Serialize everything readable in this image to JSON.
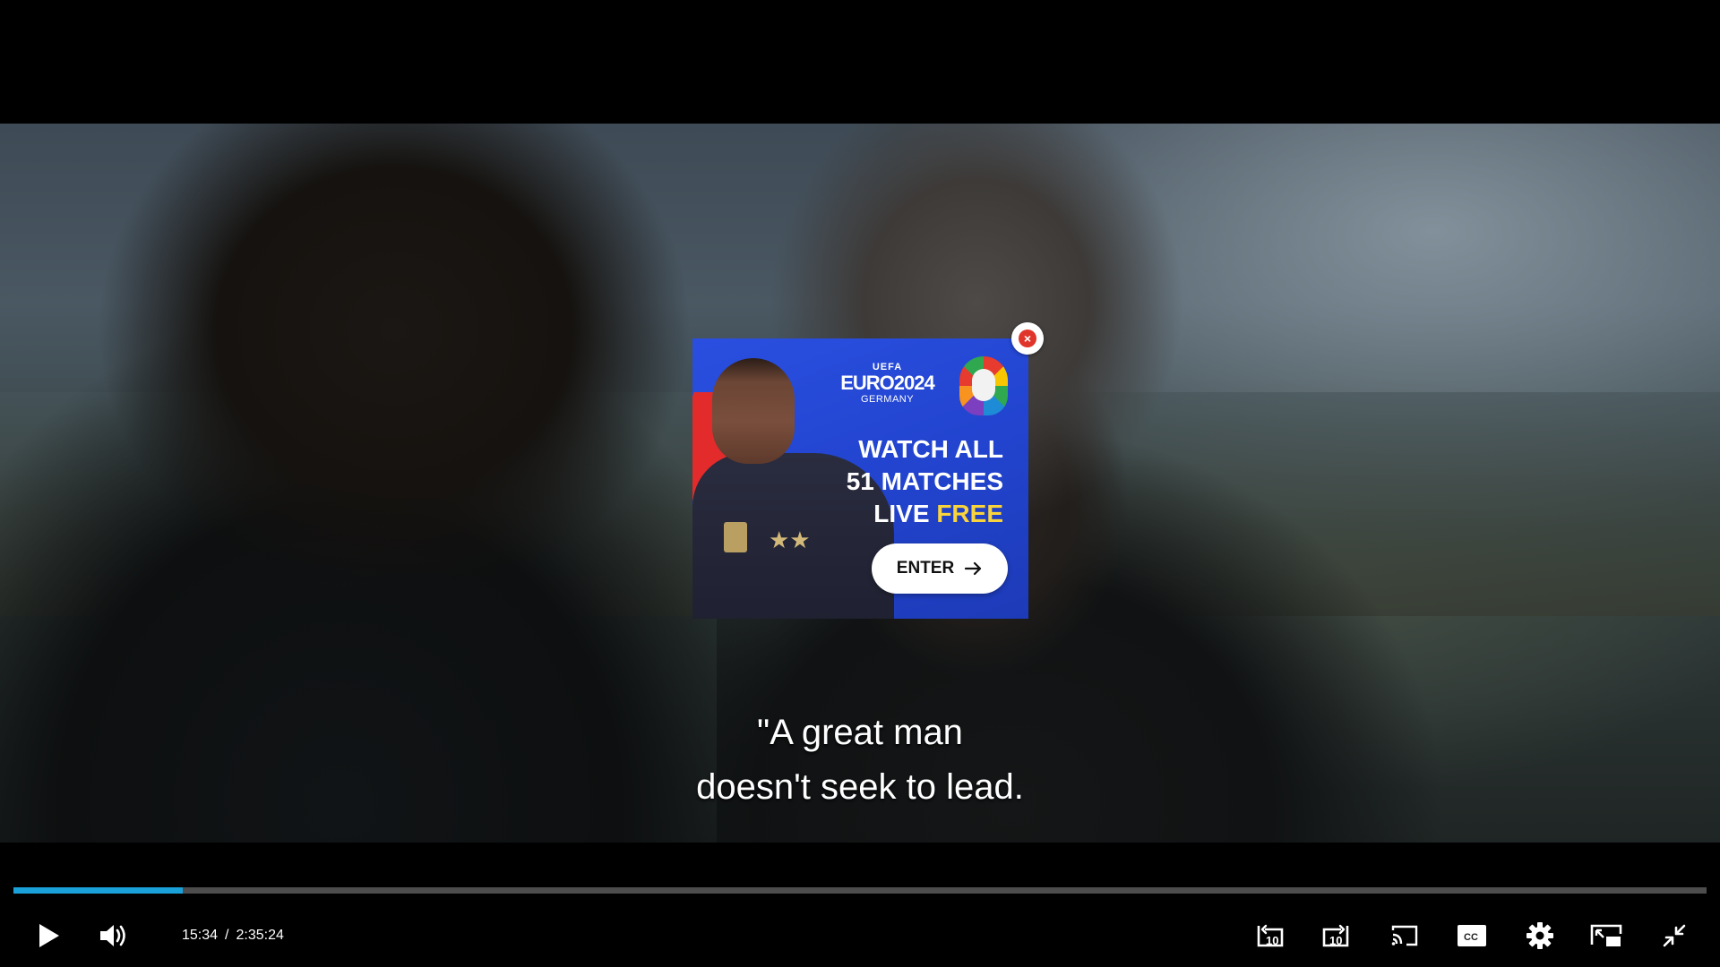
{
  "subtitles": {
    "line1": "\"A great man",
    "line2": "doesn't seek to lead."
  },
  "ad": {
    "logo_uefa": "UEFA",
    "logo_euro": "EURO2024",
    "logo_country": "GERMANY",
    "headline_line1": "WATCH ALL",
    "headline_line2": "51 MATCHES",
    "headline_live": "LIVE",
    "headline_free": "FREE",
    "enter_label": "ENTER",
    "close_glyph": "×",
    "colors": {
      "background": "#2244cf",
      "accent_free": "#f9d33c",
      "close": "#e0352b"
    }
  },
  "player": {
    "progress_percent": 10.0,
    "progress_color": "#1ba1d9",
    "current_time": "15:34",
    "time_separator": "/",
    "duration": "2:35:24",
    "icons": {
      "play": "play-icon",
      "volume": "volume-icon",
      "rewind": "rewind-10-icon",
      "forward": "forward-10-icon",
      "cast": "cast-icon",
      "captions": "captions-icon",
      "settings": "settings-icon",
      "pip": "picture-in-picture-icon",
      "exit_fullscreen": "exit-fullscreen-icon"
    },
    "captions_label": "CC"
  }
}
